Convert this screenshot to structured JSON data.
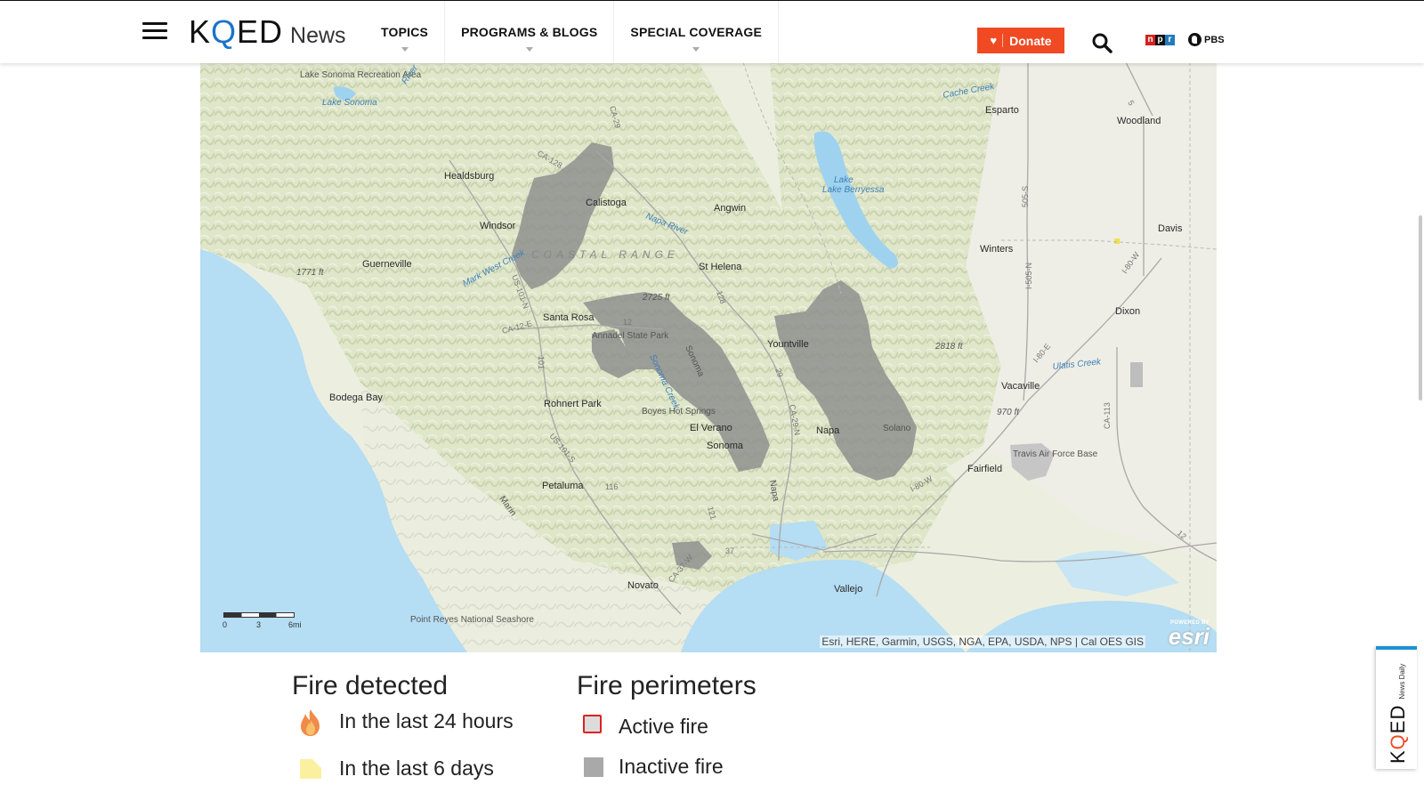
{
  "header": {
    "logo_kqed_k": "K",
    "logo_kqed_q": "Q",
    "logo_kqed_ed": "ED",
    "logo_news": "News",
    "nav": [
      {
        "label": "TOPICS"
      },
      {
        "label": "PROGRAMS & BLOGS"
      },
      {
        "label": "SPECIAL COVERAGE"
      }
    ],
    "donate_label": "Donate",
    "npr_letters": [
      "n",
      "p",
      "r"
    ],
    "pbs_label": "PBS"
  },
  "map": {
    "places": {
      "lake_sonoma_area": "Lake Sonoma Recreation Area",
      "lake_sonoma": "Lake Sonoma",
      "healdsburg": "Healdsburg",
      "calistoga": "Calistoga",
      "angwin": "Angwin",
      "lake_berryessa": "Lake Berryessa",
      "esparto": "Esparto",
      "woodland": "Woodland",
      "davis": "Davis",
      "winters": "Winters",
      "dixon": "Dixon",
      "windsor": "Windsor",
      "guerneville": "Guerneville",
      "st_helena": "St Helena",
      "santa_rosa": "Santa Rosa",
      "annadel": "Annadel State Park",
      "yountville": "Yountville",
      "vacaville": "Vacaville",
      "bodega_bay": "Bodega Bay",
      "rohnert_park": "Rohnert Park",
      "boyes": "Boyes Hot Springs",
      "el_verano": "El Verano",
      "sonoma": "Sonoma",
      "napa": "Napa",
      "solano": "Solano",
      "fairfield": "Fairfield",
      "travis": "Travis Air Force Base",
      "petaluma": "Petaluma",
      "novato": "Novato",
      "vallejo": "Vallejo",
      "point_reyes": "Point Reyes National Seashore",
      "coastal_range": "COASTAL RANGE",
      "cache_creek": "Cache Creek",
      "napa_river": "Napa River",
      "mark_west": "Mark West Creek",
      "ulatis": "Ulatis Creek",
      "russian_river": "River",
      "lake_label": "Lake",
      "sonoma_creek": "Sonoma Creek",
      "sonoma_mtn": "Sonoma",
      "marin": "Marin",
      "napa_road": "Napa"
    },
    "elevations": {
      "e1771": "1771 ft",
      "e2725": "2725 ft",
      "e2818": "2818 ft",
      "e970": "970 ft"
    },
    "roads": [
      "CA-128",
      "CA-29",
      "US-101-N",
      "CA-12-E",
      "101",
      "12",
      "US-101-S",
      "116",
      "121",
      "CA-37-W",
      "37",
      "CA-29-N",
      "29",
      "128",
      "I-80-W",
      "I-80-E",
      "I-80-W",
      "505-S",
      "I-505-N",
      "CA-113",
      "12",
      "5"
    ],
    "scale_labels": [
      "0",
      "3",
      "6mi"
    ],
    "attribution": "Esri, HERE, Garmin, USGS, NGA, EPA, USDA, NPS | Cal OES GIS",
    "esri_powered": "POWERED BY",
    "esri_name": "esri"
  },
  "legend": {
    "fire_detected_title": "Fire detected",
    "last_24": "In the last 24 hours",
    "last_6_days": "In the last 6 days",
    "fire_perimeters_title": "Fire perimeters",
    "active_fire": "Active fire",
    "inactive_fire": "Inactive fire"
  },
  "podcast_widget": {
    "k": "K",
    "q": "Q",
    "ed": "ED",
    "subtitle": "News Daily"
  },
  "colors": {
    "accent_orange": "#f04a23",
    "kqed_blue": "#1a73c9",
    "water": "#b5ddf3",
    "land": "#e9ecd8",
    "fire_perimeter": "#8c8c8c",
    "active_outline": "#e02020"
  }
}
